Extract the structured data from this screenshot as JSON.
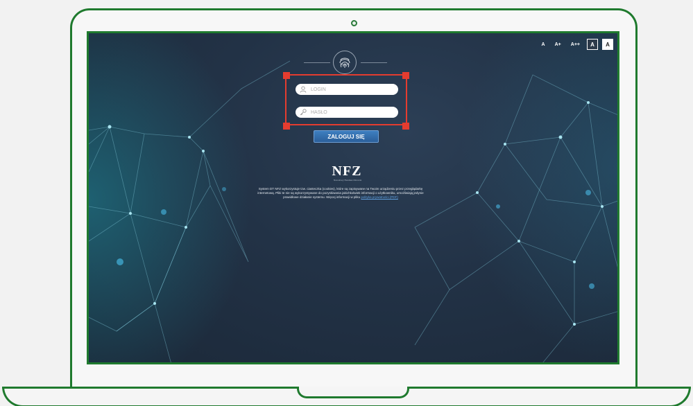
{
  "font_controls": {
    "normal": "A",
    "larger": "A+",
    "largest": "A++",
    "contrast_dark": "A",
    "contrast_light": "A"
  },
  "login_form": {
    "login_placeholder": "LOGIN",
    "password_placeholder": "HASŁO",
    "submit_label": "ZALOGUJ SIĘ"
  },
  "branding": {
    "logo_text": "NFZ",
    "logo_subtitle": "Narodowy Fundusz Zdrowia"
  },
  "cookie_notice": {
    "text": "System DT NFZ wykorzystuje tzw. ciasteczka (cookies), które są zapisywane na Twoim urządzeniu przez przeglądarkę internetową. Pliki te nie są wykorzystywane do pozyskiwania jakichkolwiek informacji o użytkowniku, umożliwiają jedynie prawidłowe działanie systemu. Więcej informacji w pliku",
    "link_text": "polityka prywatności (PDF)"
  },
  "colors": {
    "laptop_outline": "#1f7a2e",
    "screen_bg": "#223246",
    "highlight": "#e53c2f",
    "button": "#2b5f9a"
  }
}
